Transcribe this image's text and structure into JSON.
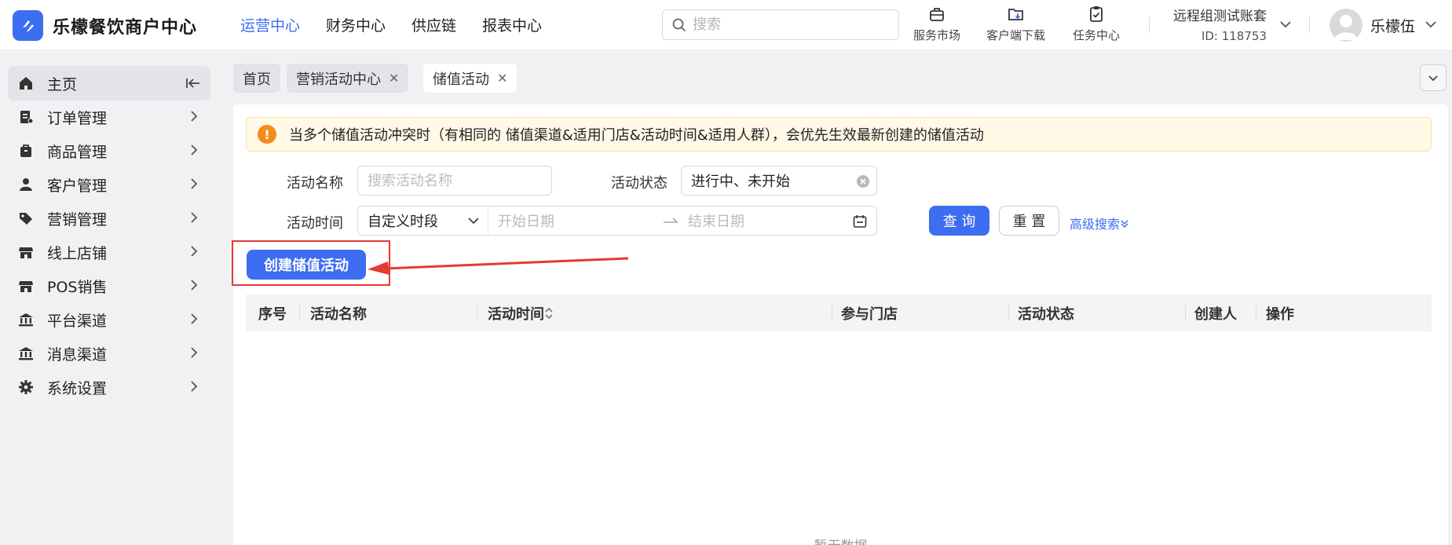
{
  "app": {
    "brand": "乐檬餐饮商户中心"
  },
  "topnav": [
    {
      "label": "运营中心",
      "active": true
    },
    {
      "label": "财务中心",
      "active": false
    },
    {
      "label": "供应链",
      "active": false
    },
    {
      "label": "报表中心",
      "active": false
    }
  ],
  "search": {
    "placeholder": "搜索"
  },
  "tools": {
    "market": "服务市场",
    "download": "客户端下载",
    "tasks": "任务中心"
  },
  "account": {
    "name": "远程组测试账套",
    "id": "ID: 118753"
  },
  "user": {
    "name": "乐檬伍"
  },
  "sidebar": {
    "items": [
      {
        "label": "主页",
        "icon": "home-icon"
      },
      {
        "label": "订单管理",
        "icon": "order-icon"
      },
      {
        "label": "商品管理",
        "icon": "goods-icon"
      },
      {
        "label": "客户管理",
        "icon": "user-icon"
      },
      {
        "label": "营销管理",
        "icon": "tag-icon"
      },
      {
        "label": "线上店铺",
        "icon": "store-icon"
      },
      {
        "label": "POS销售",
        "icon": "pos-icon"
      },
      {
        "label": "平台渠道",
        "icon": "bank-icon"
      },
      {
        "label": "消息渠道",
        "icon": "bank-icon"
      },
      {
        "label": "系统设置",
        "icon": "gear-icon"
      }
    ]
  },
  "tabs": [
    {
      "label": "首页",
      "closable": false,
      "active": false
    },
    {
      "label": "营销活动中心",
      "closable": true,
      "active": false
    },
    {
      "label": "储值活动",
      "closable": true,
      "active": true
    }
  ],
  "notice": {
    "text": "当多个储值活动冲突时（有相同的 储值渠道&适用门店&活动时间&适用人群），会优先生效最新创建的储值活动"
  },
  "filters": {
    "name_label": "活动名称",
    "name_placeholder": "搜索活动名称",
    "status_label": "活动状态",
    "status_value": "进行中、未开始",
    "time_label": "活动时间",
    "time_mode": "自定义时段",
    "start_placeholder": "开始日期",
    "end_placeholder": "结束日期",
    "query": "查 询",
    "reset": "重 置",
    "advanced": "高级搜索"
  },
  "actions": {
    "create": "创建储值活动"
  },
  "table": {
    "columns": [
      "序号",
      "活动名称",
      "活动时间",
      "参与门店",
      "活动状态",
      "创建人",
      "操作"
    ],
    "empty": "暂无数据"
  },
  "colors": {
    "primary": "#3d6df0",
    "warning": "#f28c1e",
    "annotation": "#e53935"
  }
}
